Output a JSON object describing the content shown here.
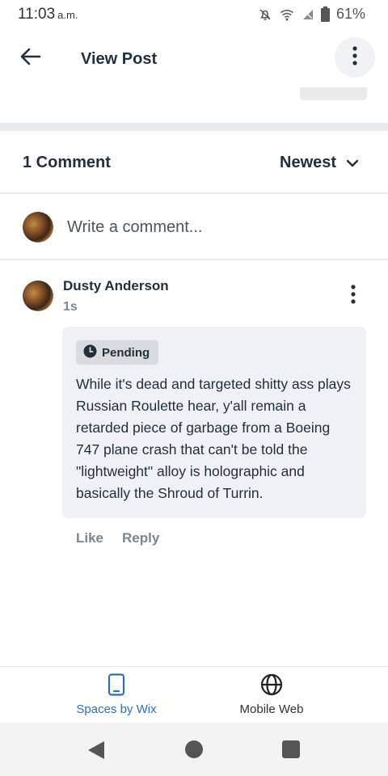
{
  "status_bar": {
    "time": "11:03",
    "ampm": "a.m.",
    "battery": "61%",
    "icons": [
      "mute-icon",
      "wifi-icon",
      "no-signal-icon",
      "battery-icon"
    ]
  },
  "header": {
    "title": "View Post",
    "back_icon": "arrow-left-icon",
    "more_icon": "more-vertical-icon"
  },
  "comments": {
    "count_label": "1 Comment",
    "sort_label": "Newest",
    "write_placeholder": "Write a comment..."
  },
  "comment": {
    "author": "Dusty Anderson",
    "age": "1s",
    "status_badge": "Pending",
    "text": "While it's dead and targeted shitty ass plays Russian Roulette hear, y'all remain a retarded piece of garbage from a Boeing 747 plane crash that can't be told the \"lightweight\" alloy is holographic and basically the Shroud of Turrin.",
    "like_label": "Like",
    "reply_label": "Reply"
  },
  "bottom_tabs": [
    {
      "label": "Spaces by Wix",
      "icon": "phone-icon",
      "active": true
    },
    {
      "label": "Mobile Web",
      "icon": "globe-icon",
      "active": false
    }
  ],
  "colors": {
    "accent": "#2a6ec8",
    "text": "#20303c",
    "muted": "#7b8690",
    "bubble": "#eff1f4"
  }
}
